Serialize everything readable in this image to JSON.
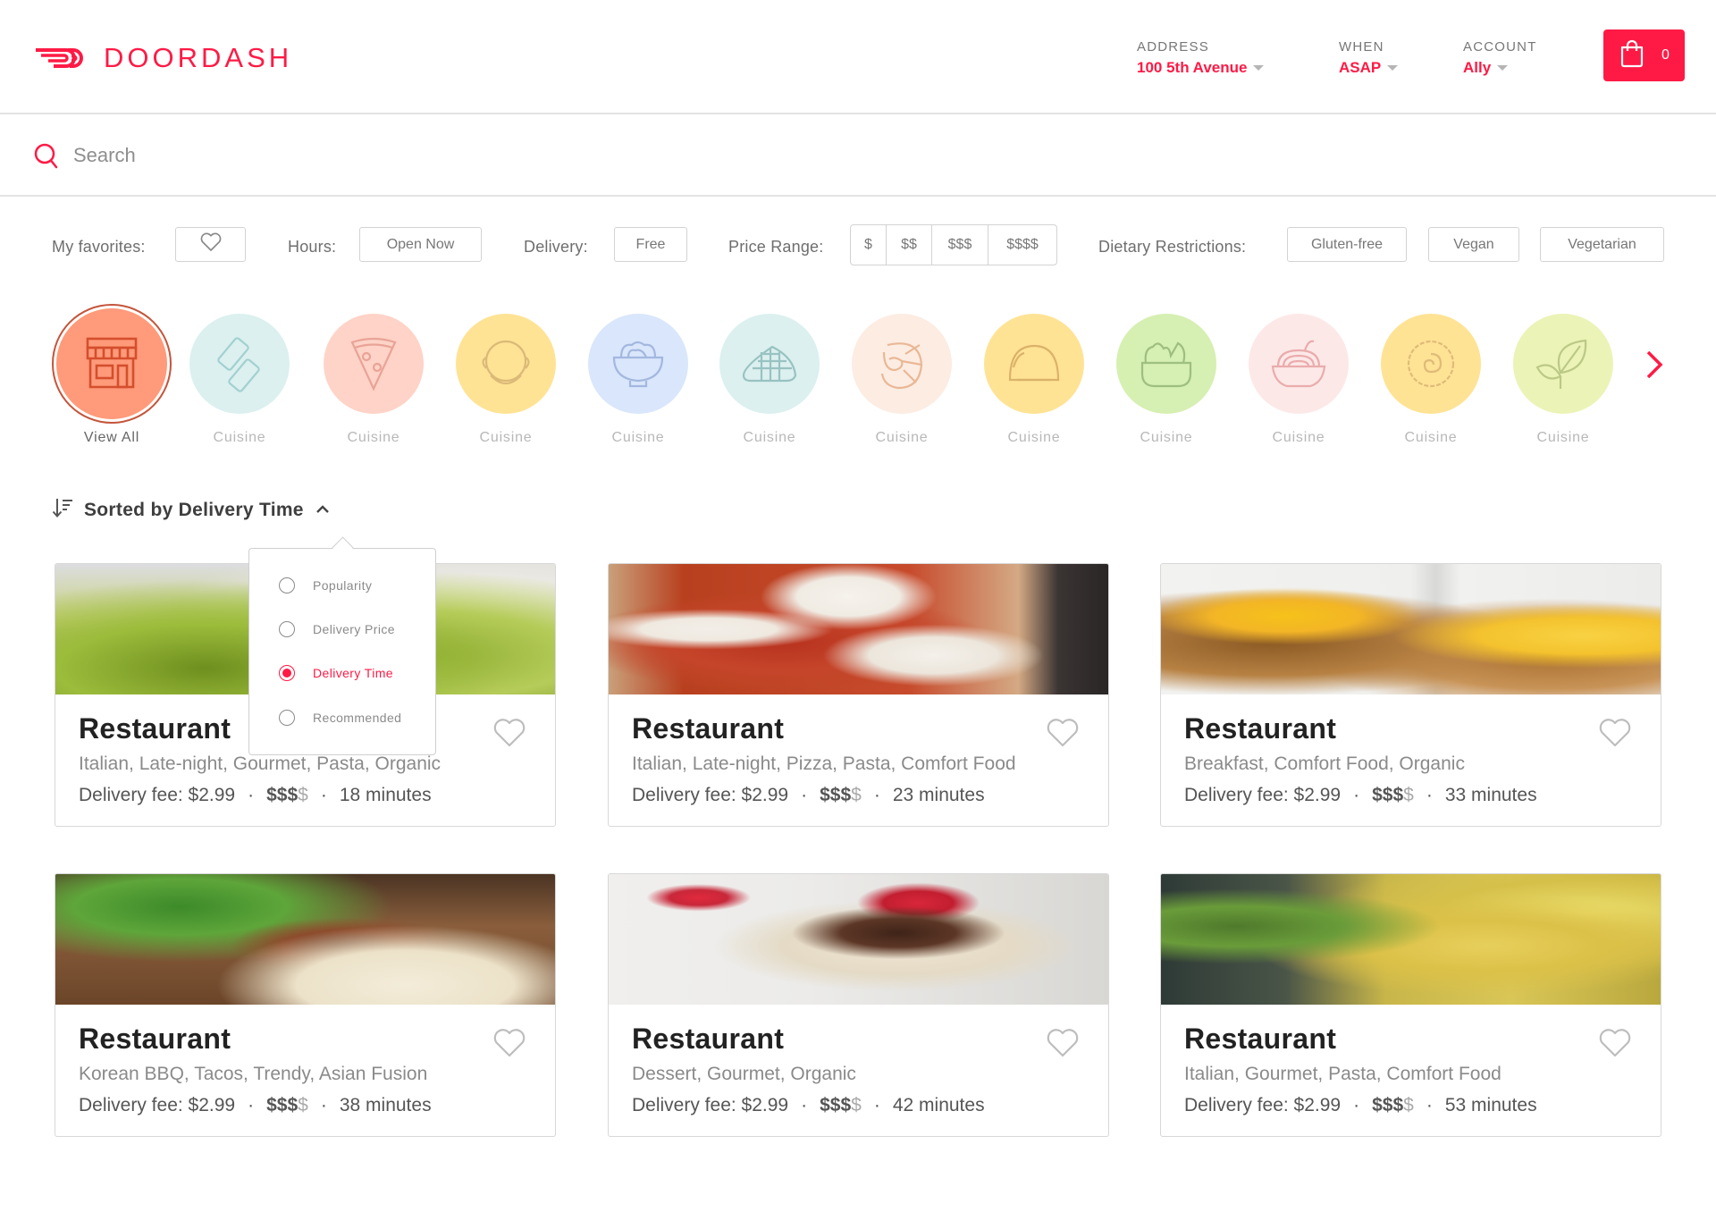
{
  "brand": {
    "name": "DOORDASH",
    "color": "#ff1a45"
  },
  "header": {
    "address": {
      "label": "ADDRESS",
      "value": "100 5th Avenue"
    },
    "when": {
      "label": "WHEN",
      "value": "ASAP"
    },
    "account": {
      "label": "ACCOUNT",
      "value": "Ally"
    },
    "cart": {
      "icon": "shopping-bag-icon",
      "count": "0"
    }
  },
  "search": {
    "placeholder": "Search",
    "value": ""
  },
  "filters": {
    "favorites": {
      "label": "My favorites:",
      "icon": "heart-icon"
    },
    "hours": {
      "label": "Hours:",
      "option": "Open Now"
    },
    "delivery": {
      "label": "Delivery:",
      "option": "Free"
    },
    "price_range": {
      "label": "Price Range:",
      "options": [
        "$",
        "$$",
        "$$$",
        "$$$$"
      ]
    },
    "dietary": {
      "label": "Dietary Restrictions:",
      "options": [
        "Gluten-free",
        "Vegan",
        "Vegetarian"
      ]
    }
  },
  "cuisines": [
    {
      "label": "View All",
      "icon": "storefront-icon",
      "color": "#ff9a7a",
      "active": true
    },
    {
      "label": "Cuisine",
      "icon": "sushi-roll-icon",
      "color": "#d8efee"
    },
    {
      "label": "Cuisine",
      "icon": "pizza-slice-icon",
      "color": "#ffcfc2"
    },
    {
      "label": "Cuisine",
      "icon": "soup-pot-icon",
      "color": "#ffe08a"
    },
    {
      "label": "Cuisine",
      "icon": "noodle-bowl-icon",
      "color": "#d5e4fb"
    },
    {
      "label": "Cuisine",
      "icon": "cake-slice-icon",
      "color": "#d8efee"
    },
    {
      "label": "Cuisine",
      "icon": "shrimp-icon",
      "color": "#fcebdf"
    },
    {
      "label": "Cuisine",
      "icon": "taco-icon",
      "color": "#ffe08a"
    },
    {
      "label": "Cuisine",
      "icon": "salad-bowl-icon",
      "color": "#d2eeaa"
    },
    {
      "label": "Cuisine",
      "icon": "pasta-bowl-icon",
      "color": "#fde6e6"
    },
    {
      "label": "Cuisine",
      "icon": "pie-icon",
      "color": "#ffe08a"
    },
    {
      "label": "Cuisine",
      "icon": "leaf-icon",
      "color": "#ebf2b0"
    }
  ],
  "sort": {
    "label": "Sorted by Delivery Time",
    "options": [
      "Popularity",
      "Delivery Price",
      "Delivery Time",
      "Recommended"
    ],
    "selected": "Delivery Time"
  },
  "restaurants": [
    {
      "name": "Restaurant",
      "tags": "Italian, Late-night, Gourmet, Pasta, Organic",
      "fee": "Delivery fee: $2.99",
      "price_on": "$$$",
      "price_off": "$",
      "time": "18 minutes",
      "image": "pesto-farfalle"
    },
    {
      "name": "Restaurant",
      "tags": "Italian, Late-night, Pizza, Pasta, Comfort Food",
      "fee": "Delivery fee: $2.99",
      "price_on": "$$$",
      "price_off": "$",
      "time": "23 minutes",
      "image": "pizza"
    },
    {
      "name": "Restaurant",
      "tags": "Breakfast, Comfort Food, Organic",
      "fee": "Delivery fee: $2.99",
      "price_on": "$$$",
      "price_off": "$",
      "time": "33 minutes",
      "image": "waffles"
    },
    {
      "name": "Restaurant",
      "tags": "Korean BBQ, Tacos, Trendy, Asian Fusion",
      "fee": "Delivery fee: $2.99",
      "price_on": "$$$",
      "price_off": "$",
      "time": "38 minutes",
      "image": "tacos"
    },
    {
      "name": "Restaurant",
      "tags": "Dessert, Gourmet, Organic",
      "fee": "Delivery fee: $2.99",
      "price_on": "$$$",
      "price_off": "$",
      "time": "42 minutes",
      "image": "dessert"
    },
    {
      "name": "Restaurant",
      "tags": "Italian, Gourmet, Pasta, Comfort Food",
      "fee": "Delivery fee: $2.99",
      "price_on": "$$$",
      "price_off": "$",
      "time": "53 minutes",
      "image": "macaroni"
    }
  ],
  "separator": "·"
}
